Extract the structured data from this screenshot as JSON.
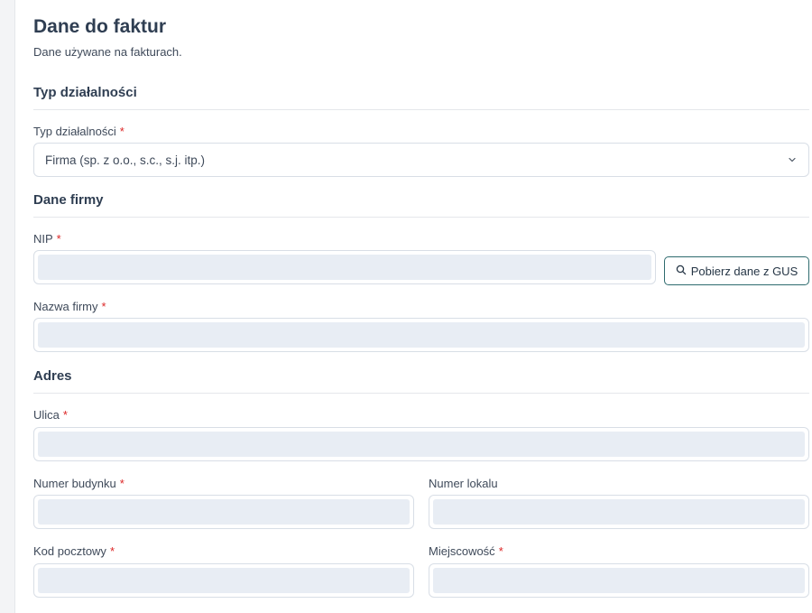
{
  "page": {
    "title": "Dane do faktur",
    "subtitle": "Dane używane na fakturach."
  },
  "sections": {
    "business_type": "Typ działalności",
    "company": "Dane firmy",
    "address": "Adres"
  },
  "fields": {
    "business_type": {
      "label": "Typ działalności",
      "required": "*",
      "value": "Firma (sp. z o.o., s.c., s.j. itp.)"
    },
    "nip": {
      "label": "NIP",
      "required": "*",
      "value": ""
    },
    "company_name": {
      "label": "Nazwa firmy",
      "required": "*",
      "value": ""
    },
    "street": {
      "label": "Ulica",
      "required": "*",
      "value": ""
    },
    "building_number": {
      "label": "Numer budynku",
      "required": "*",
      "value": ""
    },
    "unit_number": {
      "label": "Numer lokalu",
      "value": ""
    },
    "postal_code": {
      "label": "Kod pocztowy",
      "required": "*",
      "value": ""
    },
    "city": {
      "label": "Miejscowość",
      "required": "*",
      "value": ""
    }
  },
  "buttons": {
    "gus_lookup": "Pobierz dane z GUS"
  },
  "icons": {
    "select_chevron": "chevron-down-icon",
    "gus_button": "search-icon"
  },
  "colors": {
    "required": "#dc2626",
    "accent_border": "#2e6b6e",
    "input_fill": "#e8edf4"
  }
}
